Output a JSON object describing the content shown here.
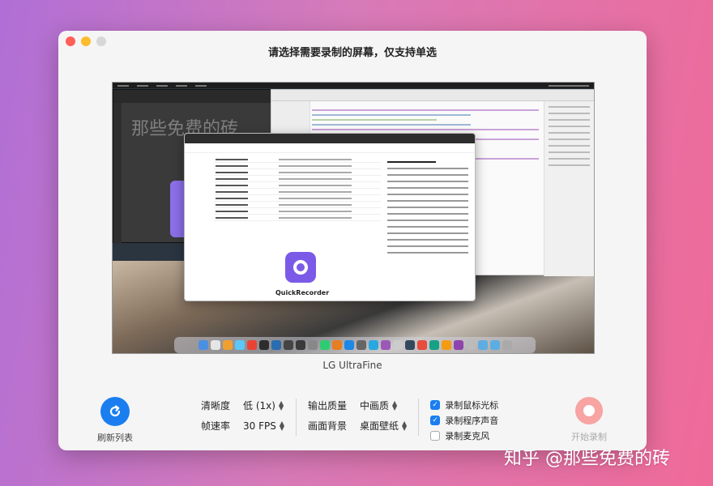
{
  "window": {
    "title": "请选择需要录制的屏幕，仅支持单选"
  },
  "preview": {
    "ps_watermark": "那些免费的砖",
    "app_name": "QuickRecorder",
    "display_name": "LG UltraFine"
  },
  "controls": {
    "refresh_label": "刷新列表",
    "resolution_label": "清晰度",
    "resolution_value": "低 (1x)",
    "framerate_label": "帧速率",
    "framerate_value": "30 FPS",
    "quality_label": "输出质量",
    "quality_value": "中画质",
    "background_label": "画面背景",
    "background_value": "桌面壁纸",
    "record_cursor": "录制鼠标光标",
    "record_cursor_checked": true,
    "record_app_audio": "录制程序声音",
    "record_app_audio_checked": true,
    "record_mic": "录制麦克风",
    "record_mic_checked": false,
    "start_label": "开始录制"
  },
  "watermark": "知乎 @那些免费的砖",
  "colors": {
    "accent": "#1a7ef0",
    "start_button": "#f7a4a2"
  }
}
